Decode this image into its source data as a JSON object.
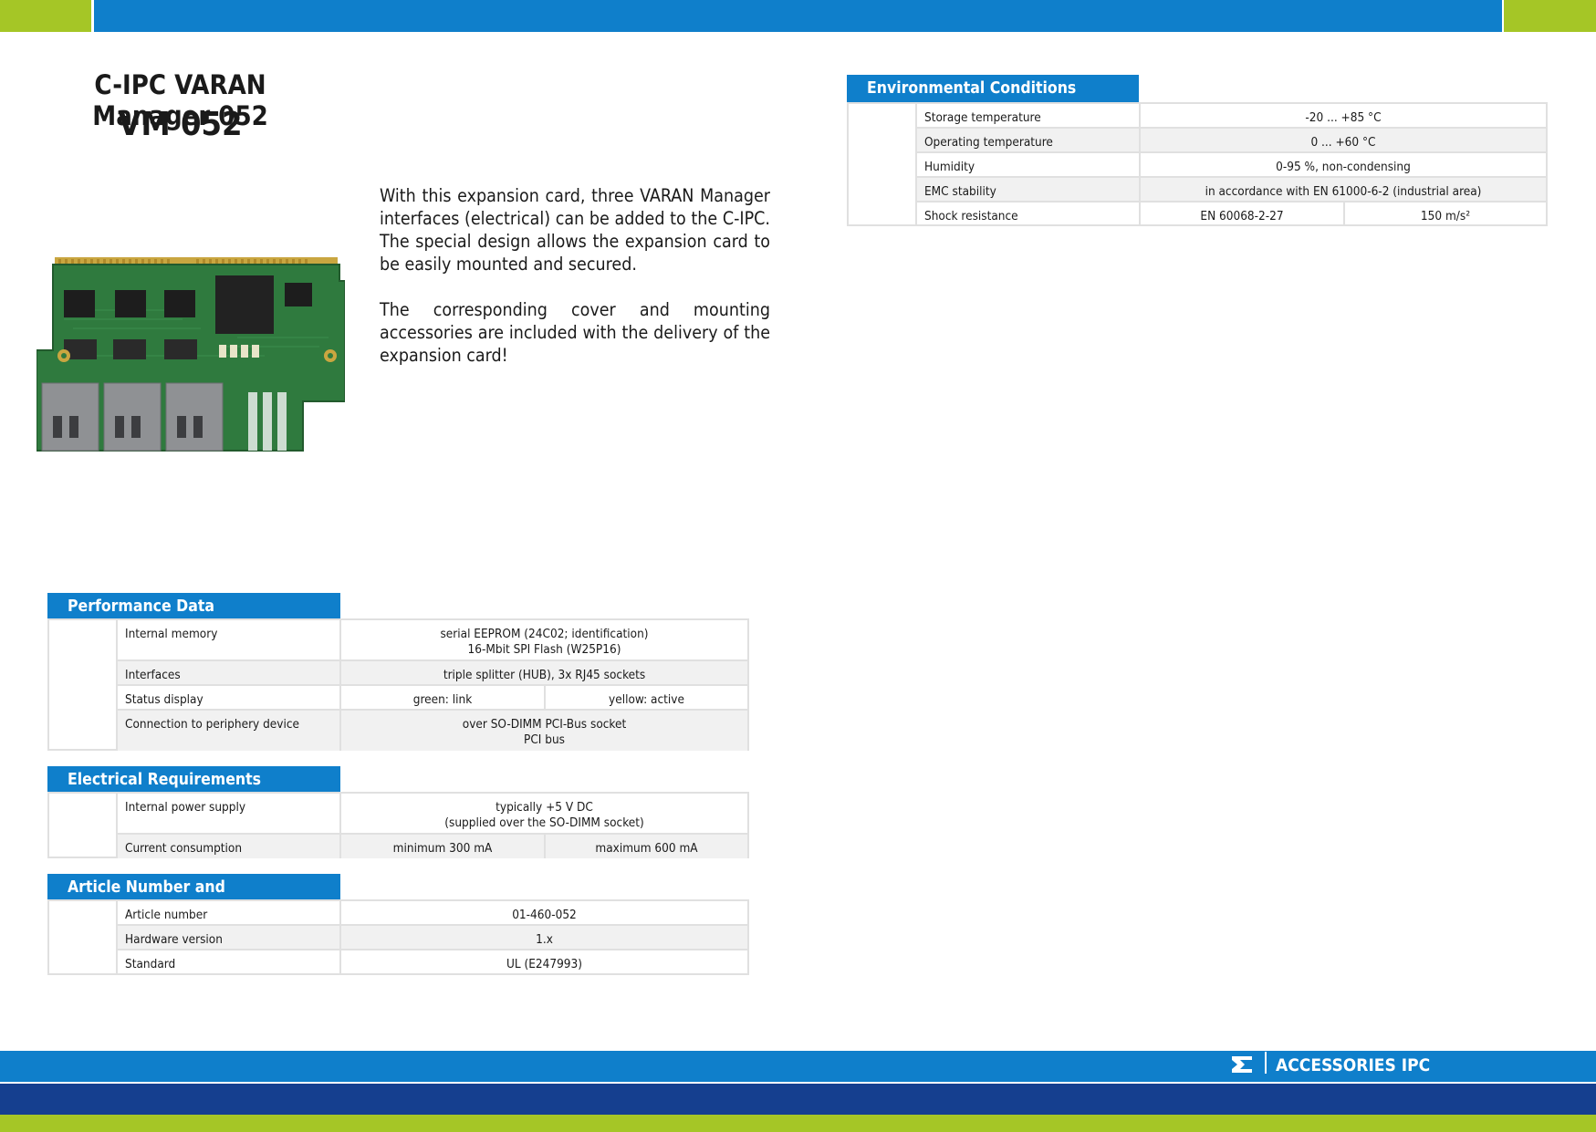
{
  "title": "C-IPC VARAN Manager 052",
  "code": "VM 052",
  "description": [
    "With this expansion card, three VARAN Manager interfaces (electrical) can be added to the C-IPC. The special design allows the expansion card to be easily mounted and secured.",
    "The corresponding cover and mounting accessories are included with the delivery of the expansion card!"
  ],
  "env": {
    "heading": "Environmental Conditions",
    "rows": [
      {
        "label": "Storage temperature",
        "value": "-20 ... +85 °C"
      },
      {
        "label": "Operating temperature",
        "value": "0 ... +60 °C"
      },
      {
        "label": "Humidity",
        "value": "0-95 %, non-condensing"
      },
      {
        "label": "EMC stability",
        "value": "in accordance with EN 61000-6-2 (industrial area)"
      },
      {
        "label": "Shock resistance",
        "value": "EN 60068-2-27",
        "value2": "150 m/s²"
      }
    ]
  },
  "perf": {
    "heading": "Performance Data",
    "rows": [
      {
        "label": "Internal memory",
        "value_l1": "serial EEPROM (24C02; identification)",
        "value_l2": "16-Mbit SPI Flash (W25P16)"
      },
      {
        "label": "Interfaces",
        "value": "triple splitter (HUB), 3x RJ45 sockets"
      },
      {
        "label": "Status display",
        "value": "green: link",
        "value2": "yellow: active"
      },
      {
        "label": "Connection to periphery device",
        "value_l1": "over SO-DIMM PCI-Bus socket",
        "value_l2": "PCI bus"
      }
    ]
  },
  "elec": {
    "heading": "Electrical Requirements",
    "rows": [
      {
        "label": "Internal power supply",
        "value_l1": "typically +5 V DC",
        "value_l2": "(supplied over the SO-DIMM socket)"
      },
      {
        "label": "Current consumption",
        "value": "minimum 300 mA",
        "value2": "maximum 600 mA"
      }
    ]
  },
  "misc": {
    "heading": "Article Number and Miscellaneous",
    "rows": [
      {
        "label": "Article number",
        "value": "01-460-052"
      },
      {
        "label": "Hardware version",
        "value": "1.x"
      },
      {
        "label": "Standard",
        "value": "UL (E247993)"
      }
    ]
  },
  "footer": {
    "label": "ACCESSORIES IPC"
  },
  "colors": {
    "blue": "#0f7fcb",
    "navy": "#153f8f",
    "green": "#a5c626"
  }
}
